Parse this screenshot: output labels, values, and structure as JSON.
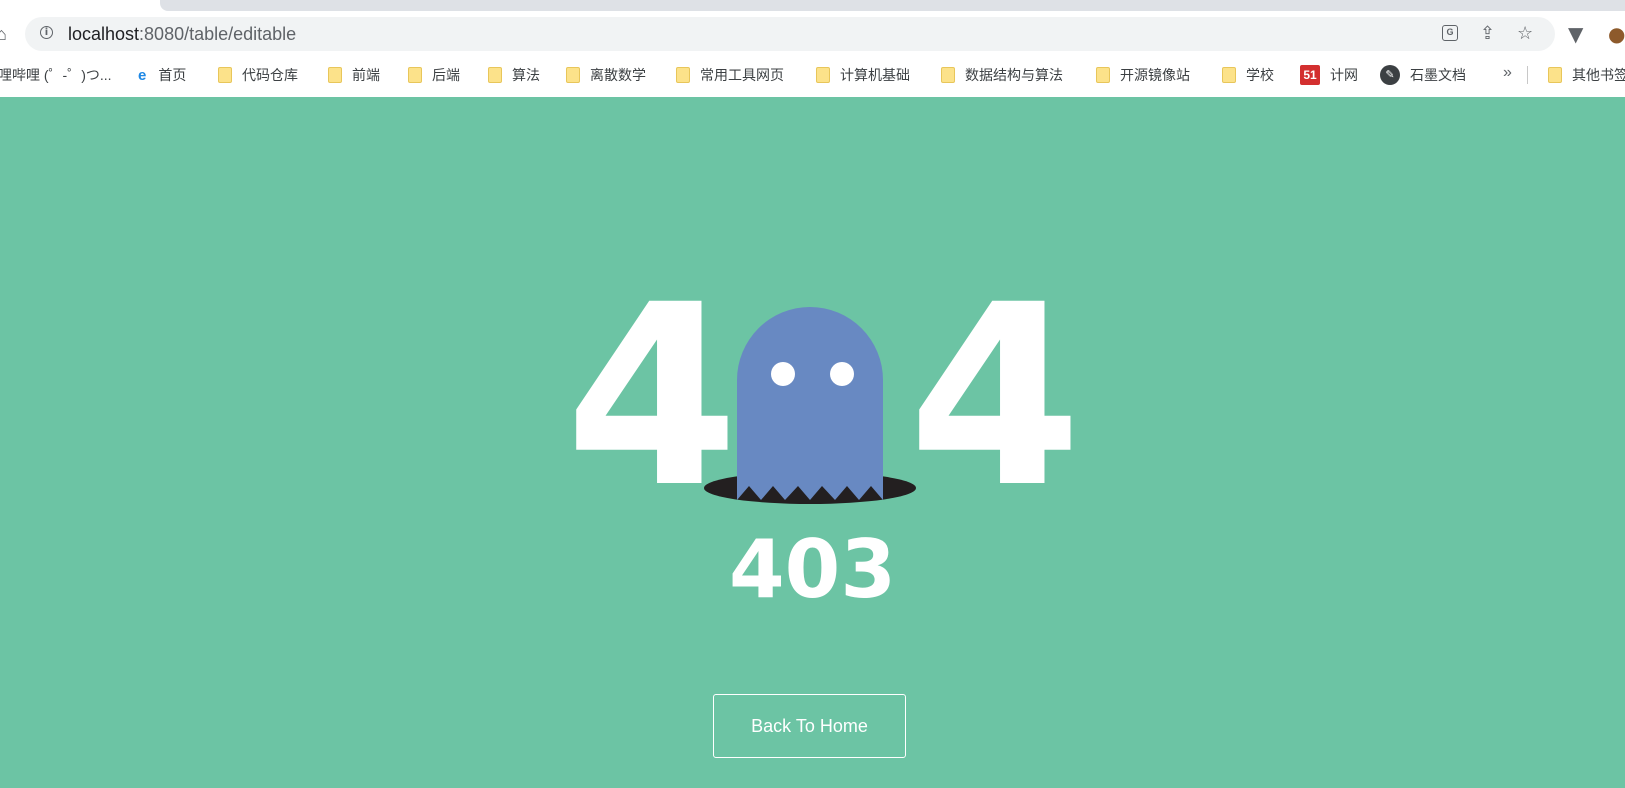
{
  "browser": {
    "url_host": "localhost",
    "url_rest": ":8080/table/editable",
    "bookmarks": [
      {
        "label": "哩哔哩 (゜-゜)つ...",
        "icon": "none"
      },
      {
        "label": "首页",
        "icon": "edge-icon"
      },
      {
        "label": "代码仓库",
        "icon": "folder-icon"
      },
      {
        "label": "前端",
        "icon": "folder-icon"
      },
      {
        "label": "后端",
        "icon": "folder-icon"
      },
      {
        "label": "算法",
        "icon": "folder-icon"
      },
      {
        "label": "离散数学",
        "icon": "folder-icon"
      },
      {
        "label": "常用工具网页",
        "icon": "folder-icon"
      },
      {
        "label": "计算机基础",
        "icon": "folder-icon"
      },
      {
        "label": "数据结构与算法",
        "icon": "folder-icon"
      },
      {
        "label": "开源镜像站",
        "icon": "folder-icon"
      },
      {
        "label": "学校",
        "icon": "folder-icon"
      },
      {
        "label": "计网",
        "icon": "51-icon"
      },
      {
        "label": "石墨文档",
        "icon": "shimo-icon"
      },
      {
        "label": "其他书签",
        "icon": "folder-icon"
      }
    ],
    "more_chevron": "»"
  },
  "page": {
    "digit_left": "4",
    "digit_right": "4",
    "error_code": "403",
    "back_button": "Back To Home",
    "colors": {
      "background": "#6cc4a4",
      "ghost": "#6889c2",
      "hole": "#231f20",
      "text": "#ffffff"
    }
  }
}
